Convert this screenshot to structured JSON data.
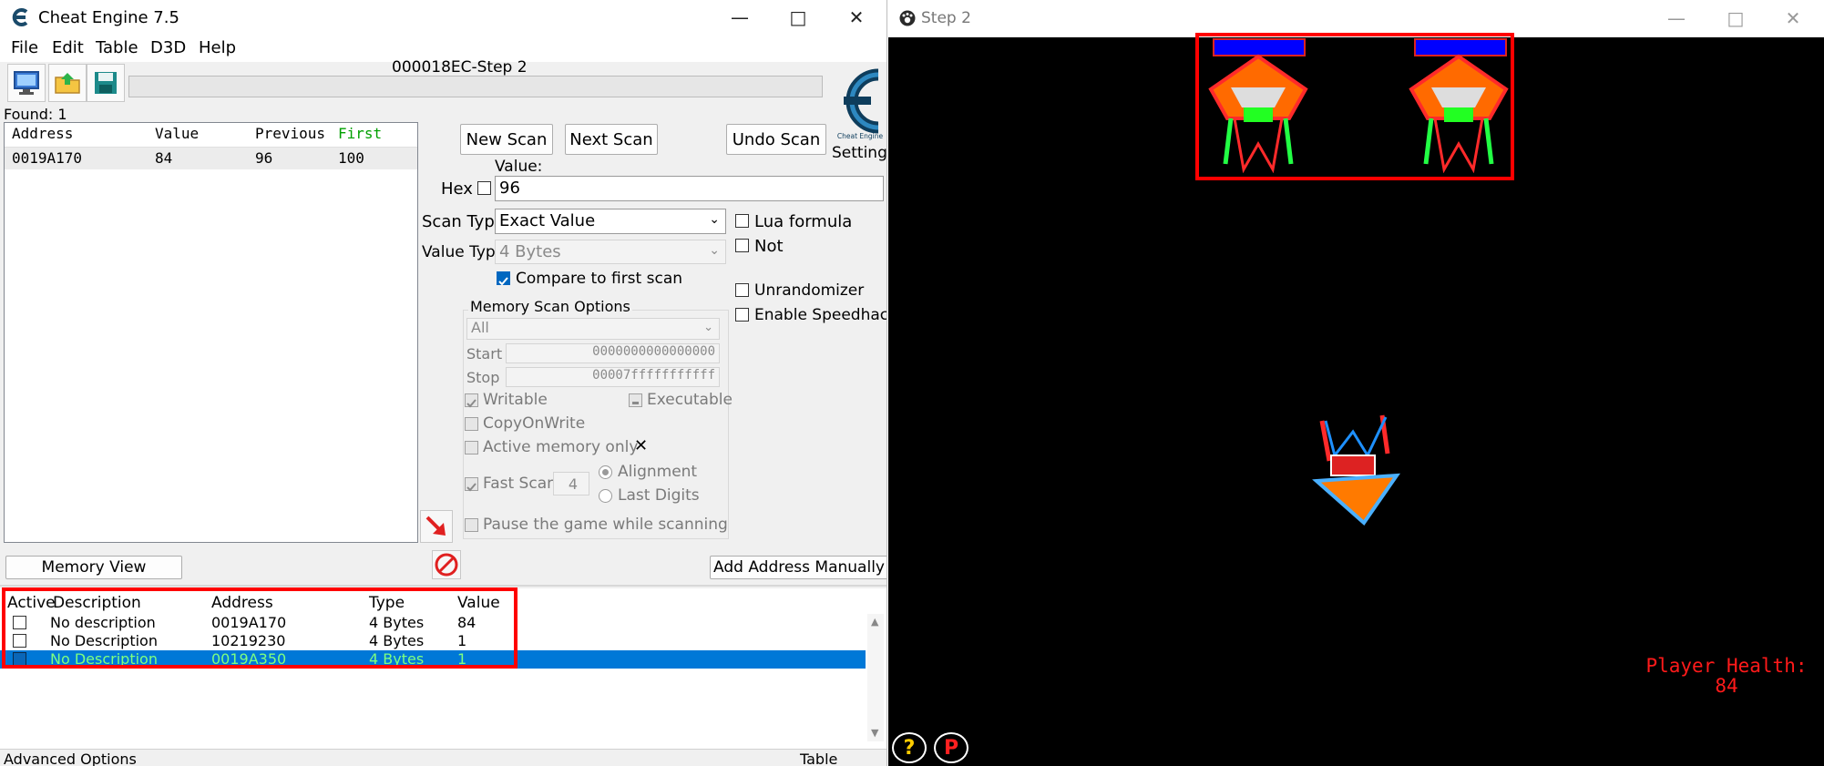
{
  "ce": {
    "title": "Cheat Engine 7.5",
    "menu": [
      "File",
      "Edit",
      "Table",
      "D3D",
      "Help"
    ],
    "process_title": "000018EC-Step 2",
    "logo_label": "Cheat Engine",
    "settings_label": "Settings",
    "found_label": "Found: 1",
    "results": {
      "columns": [
        "Address",
        "Value",
        "Previous",
        "First"
      ],
      "rows": [
        {
          "address": "0019A170",
          "value": "84",
          "previous": "96",
          "first": "100"
        }
      ]
    },
    "buttons": {
      "new_scan": "New Scan",
      "next_scan": "Next Scan",
      "undo_scan": "Undo Scan",
      "memory_view": "Memory View",
      "add_address": "Add Address Manually"
    },
    "value_label": "Value:",
    "hex_label": "Hex",
    "value_input": "96",
    "scan_type_label": "Scan Type",
    "scan_type_value": "Exact Value",
    "value_type_label": "Value Type",
    "value_type_value": "4 Bytes",
    "lua_formula_label": "Lua formula",
    "not_label": "Not",
    "compare_first_label": "Compare to first scan",
    "unrandomizer_label": "Unrandomizer",
    "speedhack_label": "Enable Speedhack",
    "memory_scan_options": {
      "title": "Memory Scan Options",
      "region": "All",
      "start_label": "Start",
      "start_value": "0000000000000000",
      "stop_label": "Stop",
      "stop_value": "00007fffffffffff",
      "writable": "Writable",
      "executable": "Executable",
      "copy_on_write": "CopyOnWrite",
      "active_memory_only": "Active memory only",
      "fast_scan": "Fast Scan",
      "fast_scan_value": "4",
      "alignment": "Alignment",
      "last_digits": "Last Digits",
      "pause_game": "Pause the game while scanning"
    },
    "address_list": {
      "columns": [
        "Active",
        "Description",
        "Address",
        "Type",
        "Value"
      ],
      "rows": [
        {
          "description": "No description",
          "address": "0019A170",
          "type": "4 Bytes",
          "value": "84"
        },
        {
          "description": "No Description",
          "address": "10219230",
          "type": "4 Bytes",
          "value": "1"
        },
        {
          "description": "No Description",
          "address": "0019A350",
          "type": "4 Bytes",
          "value": "1"
        }
      ]
    },
    "advanced_options": "Advanced Options",
    "table_extras": "Table Extras",
    "colors": {
      "first_column": "#00a000",
      "selected_row": "#0078d7",
      "selected_text": "#7fff7f",
      "highlight": "#ff0000"
    }
  },
  "game": {
    "title": "Step 2",
    "health_label": "Player Health:",
    "health_value": "84",
    "help_button": "?",
    "pause_button": "P",
    "colors": {
      "health_text": "#ff1a1a",
      "bar": "#0000ff"
    }
  }
}
